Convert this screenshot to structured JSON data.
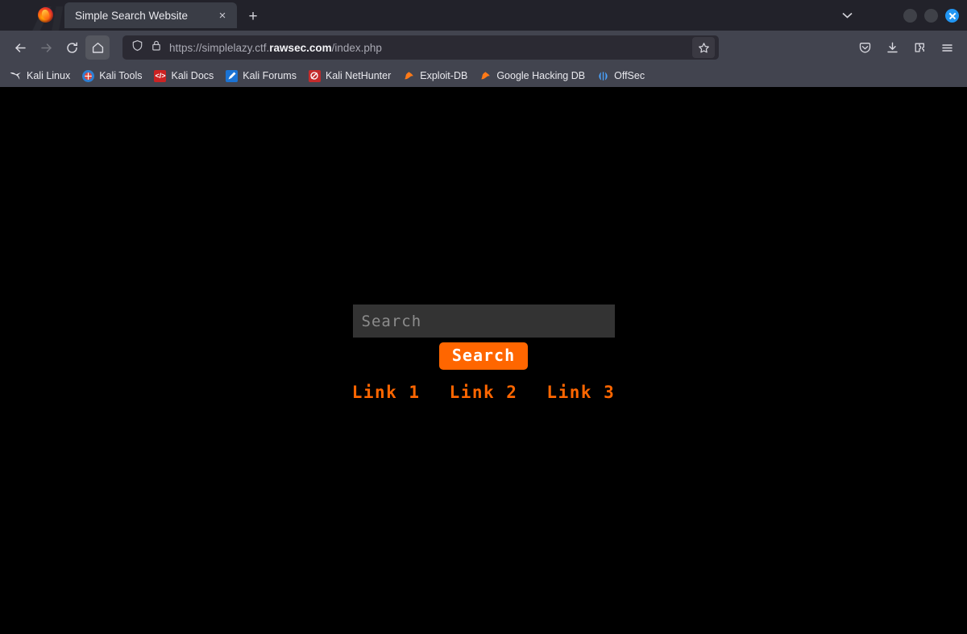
{
  "window": {
    "tab_list_icon": "chevron-down-icon",
    "minimize_label": "",
    "maximize_label": "",
    "close_label": "",
    "close_color": "#2196f3"
  },
  "tabbar": {
    "tab_title": "Simple Search Website",
    "close_glyph": "×",
    "new_tab_glyph": "+",
    "chevron_glyph": "⌄"
  },
  "toolbar": {
    "back_icon": "back-arrow-icon",
    "forward_icon": "forward-arrow-icon",
    "reload_icon": "reload-icon",
    "home_icon": "home-icon",
    "shield_icon": "shield-icon",
    "lock_icon": "padlock-icon",
    "bookmark_star_icon": "star-icon",
    "pocket_icon": "pocket-icon",
    "downloads_icon": "download-icon",
    "extensions_icon": "extensions-icon",
    "menu_icon": "hamburger-menu-icon",
    "url_prefix": "https://simplelazy.ctf.",
    "url_domain": "rawsec.com",
    "url_suffix": "/index.php"
  },
  "bookmarks": {
    "items": [
      {
        "label": "Kali Linux",
        "icon": "kali-dragon-icon",
        "glyph": "✒",
        "color": "#e8e8ee",
        "bg": "transparent"
      },
      {
        "label": "Kali Tools",
        "icon": "kali-tools-icon",
        "glyph": "⚙",
        "color": "#ffffff",
        "bg": "#2b7fd4"
      },
      {
        "label": "Kali Docs",
        "icon": "kali-docs-icon",
        "glyph": "≡",
        "color": "#ffffff",
        "bg": "#cc2222"
      },
      {
        "label": "Kali Forums",
        "icon": "kali-forums-icon",
        "glyph": "✒",
        "color": "#ffffff",
        "bg": "#1a73d4"
      },
      {
        "label": "Kali NetHunter",
        "icon": "kali-nethunter-icon",
        "glyph": "◑",
        "color": "#ffffff",
        "bg": "#c42b2b"
      },
      {
        "label": "Exploit-DB",
        "icon": "exploit-db-icon",
        "glyph": "❖",
        "color": "#ff7a18",
        "bg": "transparent"
      },
      {
        "label": "Google Hacking DB",
        "icon": "google-hacking-db-icon",
        "glyph": "❖",
        "color": "#ff7a18",
        "bg": "transparent"
      },
      {
        "label": "OffSec",
        "icon": "offsec-icon",
        "glyph": "◐",
        "color": "#4aa3ff",
        "bg": "transparent"
      }
    ]
  },
  "page": {
    "background": "#000000",
    "accent": "#ff6600",
    "search": {
      "placeholder": "Search",
      "value": "",
      "button_label": "Search"
    },
    "links": [
      {
        "label": "Link 1"
      },
      {
        "label": "Link 2"
      },
      {
        "label": "Link 3"
      }
    ]
  }
}
